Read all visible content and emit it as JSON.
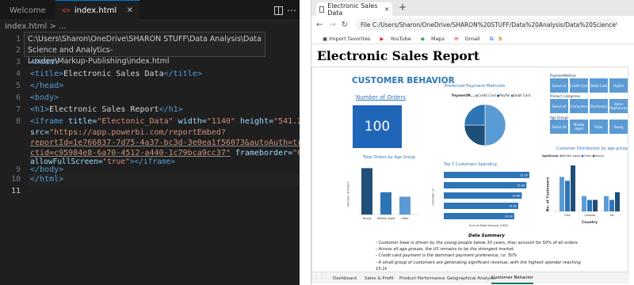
{
  "editor": {
    "tabs": [
      {
        "label": "Welcome"
      },
      {
        "label": "index.html"
      }
    ],
    "breadcrumb": "index.html > ...",
    "path_tooltip": [
      "C:\\Users\\Sharon\\OneDrive\\SHARON STUFF\\Data Analysis\\Data Science and Analytics-",
      "Luxdev\\Markup-Publishing\\index.html"
    ],
    "line_numbers": [
      "1",
      "2",
      "3",
      "4",
      "5",
      "6",
      "7",
      "8",
      "9",
      "10",
      "11"
    ],
    "active_line": "11",
    "code": {
      "l3": "<head>",
      "l4a": "<title>",
      "l4b": "Electronic Sales Data",
      "l4c": "</title>",
      "l5": "</head>",
      "l6": "<body>",
      "l7a": "<h1>",
      "l7b": "Electronic Sales Report",
      "l7c": "</h1>",
      "l8a": "<iframe",
      "l8b": " title=",
      "l8c": "\"Electonic_Data\"",
      "l8d": " width=",
      "l8e": "\"1140\"",
      "l8f": " height=",
      "l8g": "\"541.25\"",
      "l8h": "src=",
      "l8i": "\"https://app.powerbi.com/reportEmbed?",
      "l8j": "reportId=1e766837-7d75-4a37-bc3d-3e0ea1f56073&autoAuth=true&",
      "l8k": "ctid=c95984e8-6a70-4512-a440-1c79bca9cc37\"",
      "l8l": " frameborder=",
      "l8m": "\"0\"",
      "l8n": "allowFullScreen=",
      "l8o": "\"true\"",
      "l8p": "></iframe>",
      "l9": "</body>",
      "l10": "</html>"
    },
    "icons": [
      "vscode-icon",
      "html-file-icon",
      "close-icon",
      "split-editor-icon",
      "more-icon"
    ]
  },
  "browser": {
    "tab_title": "Electronic Sales Data",
    "new_tab": "+",
    "url": "File   C:/Users/Sharon/OneDrive/SHARON%20STUFF/Data%20Analysis/Data%20Science%20and%20Analytics-%20Luxdev/Markup-P...",
    "bookmarks": [
      "Import favorites",
      "YouTube",
      "Maps",
      "Gmail",
      "G",
      "S"
    ],
    "page_heading": "Electronic Sales Report"
  },
  "report": {
    "title": "CUSTOMER BEHAVIOR",
    "kpi_label": "Number of Orders",
    "kpi_value": "100",
    "payment": {
      "title": "Preferred Payment Methods",
      "legend_title": "PaymentM...",
      "legend": [
        "Credit Card",
        "PayPal",
        "Debit Card"
      ],
      "colors": [
        "#5b9bd5",
        "#1f4e79",
        "#2e75b6"
      ],
      "shares": [
        0.5,
        0.25,
        0.25
      ]
    },
    "slicers": {
      "payment_label": "PaymentMethod",
      "payment": [
        "Select all",
        "Credit Card",
        "Debit Card",
        "PayPal"
      ],
      "category_label": "Product Categories",
      "category": [
        "Select all",
        "Computers",
        "Electronics",
        "Home Appliances"
      ],
      "age_label": "Age Groups",
      "age": [
        "Select all",
        "Middle Aged",
        "Older",
        "Young"
      ]
    },
    "orders_by_age": {
      "title": "Total Orders by Age Group",
      "ylabel": "Number of Orders",
      "categories": [
        "Young",
        "Middle Aged",
        "Older"
      ],
      "values": [
        52,
        25,
        20
      ],
      "ymax": 55
    },
    "top5": {
      "title": "Top 5 Customers Spending",
      "ylabel": "customer_id",
      "xlabel": "Sum of Sales Amount (USD)",
      "labels": [
        "15.1K",
        "15.0K",
        "14.6K",
        "14.4K",
        "14.1K"
      ],
      "values": [
        15.1,
        15.0,
        14.6,
        14.4,
        14.1
      ]
    },
    "dist": {
      "title": "Customer Distribution by age group",
      "legend_title": "AgeGroup",
      "legend": [
        "Middle Aged",
        "Older",
        "Young"
      ],
      "colors": [
        "#5b9bd5",
        "#2e75b6",
        "#1f4e79"
      ],
      "ylabel": "No. of Customers",
      "xlabel": "Country",
      "categories": [
        "USA",
        "Canada",
        "UK"
      ],
      "groups": [
        [
          9,
          8,
          12
        ],
        [
          4,
          3,
          3
        ],
        [
          4,
          3,
          5
        ]
      ],
      "ymax": 12
    },
    "summary_title": "Data Summary",
    "summary": [
      "- Customer base is driven by the young people below 30 years, they account for 50% of all orders.",
      "- Across all age groups, the US remains to be the strongest market.",
      "- Credit card payment is the dominant payment preference, i.e. 50%",
      "- A small group of customers are generating significant revenue, with the highest spender reaching 15.1k"
    ],
    "page_tabs": [
      "Dashboard",
      "Sales & Profit",
      "Product Performance",
      "Geographical Analysis",
      "Customer Behavior"
    ],
    "active_tab": "Customer Behavior"
  },
  "chart_data": [
    {
      "type": "pie",
      "title": "Preferred Payment Methods",
      "categories": [
        "Credit Card",
        "PayPal",
        "Debit Card"
      ],
      "values": [
        50,
        25,
        25
      ]
    },
    {
      "type": "bar",
      "title": "Total Orders by Age Group",
      "xlabel": "",
      "ylabel": "Number of Orders",
      "categories": [
        "Young",
        "Middle Aged",
        "Older"
      ],
      "values": [
        52,
        25,
        20
      ]
    },
    {
      "type": "bar",
      "title": "Top 5 Customers Spending",
      "xlabel": "Sum of Sales Amount (USD)",
      "ylabel": "customer_id",
      "values": [
        15.1,
        15.0,
        14.6,
        14.4,
        14.1
      ]
    },
    {
      "type": "bar",
      "title": "Customer Distribution by age group",
      "xlabel": "Country",
      "ylabel": "No. of Customers",
      "categories": [
        "USA",
        "Canada",
        "UK"
      ],
      "series": [
        {
          "name": "Middle Aged",
          "values": [
            9,
            4,
            4
          ]
        },
        {
          "name": "Older",
          "values": [
            8,
            3,
            3
          ]
        },
        {
          "name": "Young",
          "values": [
            12,
            3,
            5
          ]
        }
      ]
    }
  ]
}
